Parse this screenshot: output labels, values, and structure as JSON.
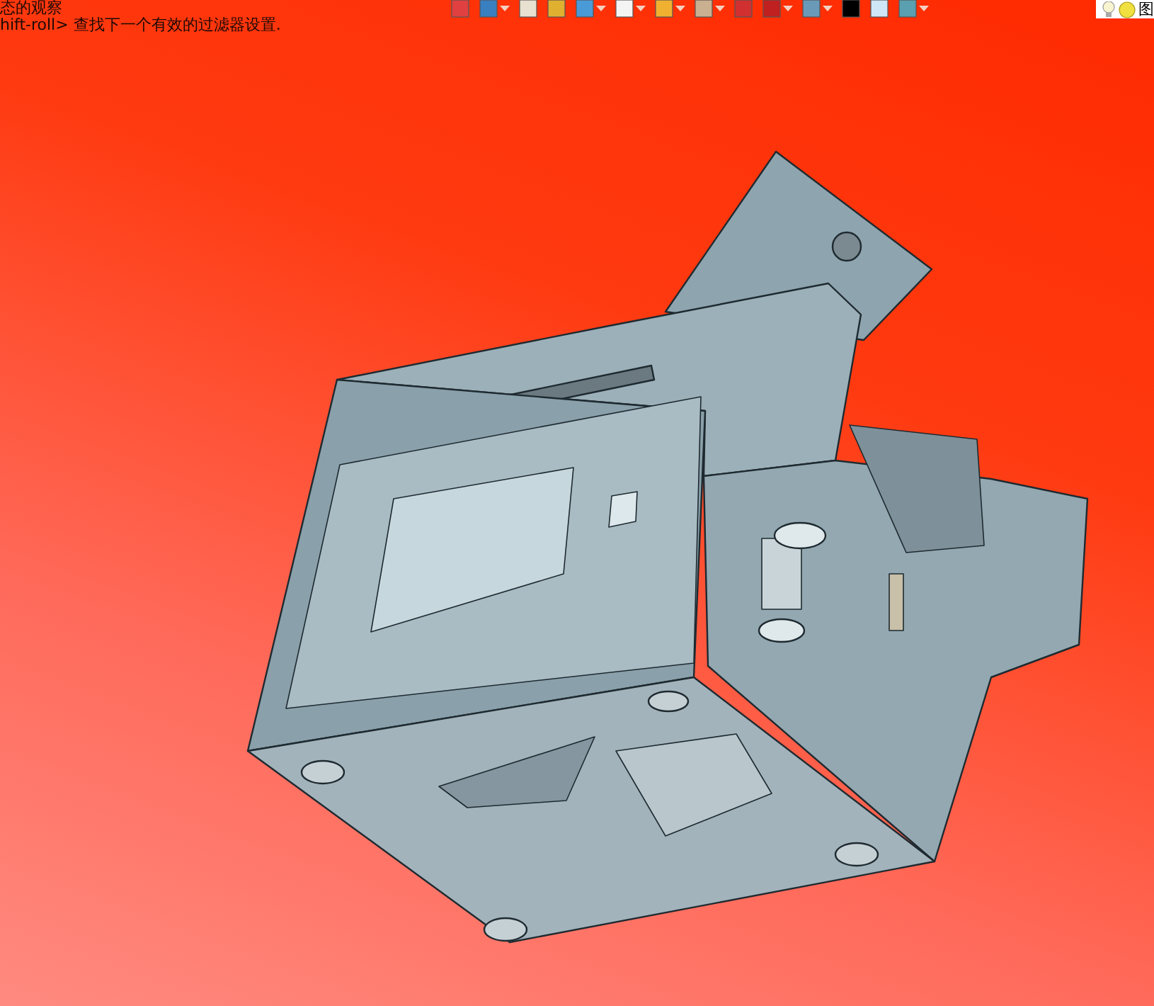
{
  "status_lines": [
    "态的观察",
    "hift-roll> 查找下一个有效的过滤器设置."
  ],
  "toolbar": {
    "panel_label": "图"
  }
}
